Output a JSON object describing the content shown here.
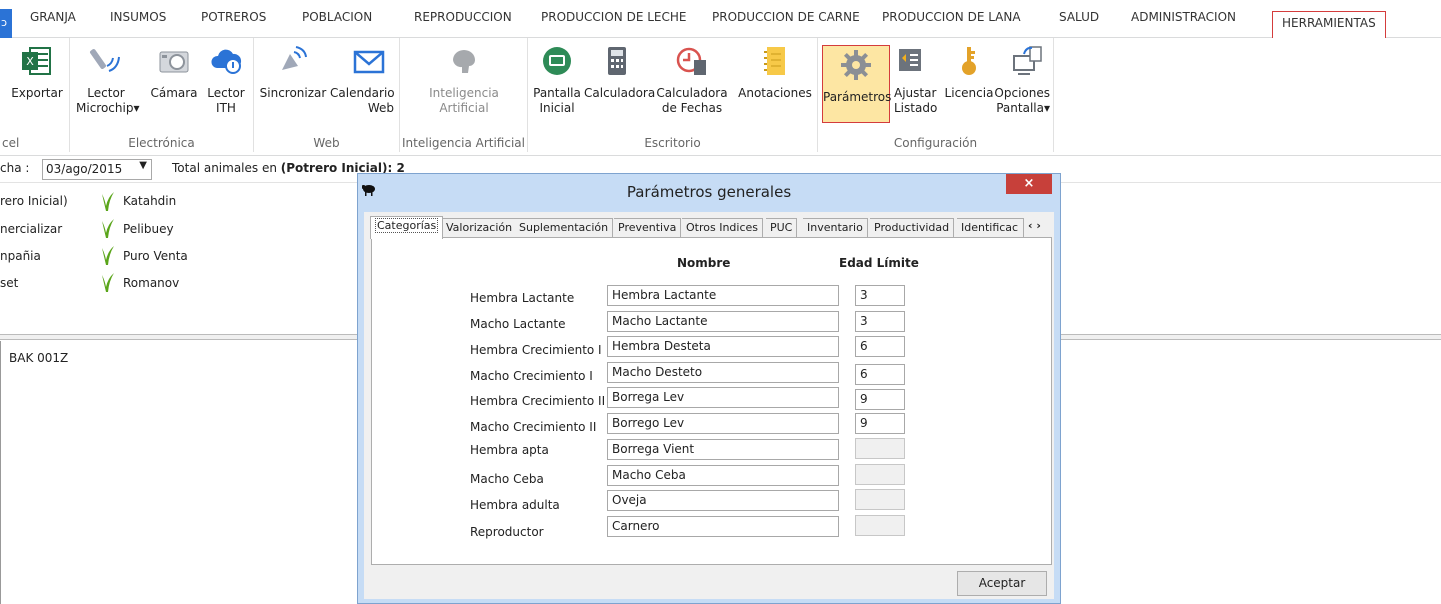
{
  "menu": {
    "file_label": "ɔ",
    "items": [
      "GRANJA",
      "INSUMOS",
      "POTREROS",
      "POBLACION",
      "REPRODUCCION",
      "PRODUCCION DE LECHE",
      "PRODUCCION DE CARNE",
      "PRODUCCION DE LANA",
      "SALUD",
      "ADMINISTRACION",
      "HERRAMIENTAS"
    ],
    "active": "HERRAMIENTAS"
  },
  "ribbon": {
    "groups": {
      "excel": {
        "label": "cel",
        "buttons": [
          "Exportar"
        ]
      },
      "electronica": {
        "label": "Electrónica",
        "buttons": [
          "Lector\nMicrochip▾",
          "Cámara",
          "Lector\nITH"
        ]
      },
      "web": {
        "label": "Web",
        "buttons": [
          "Sincronizar",
          "Calendario\nWeb"
        ]
      },
      "ia": {
        "label": "Inteligencia Artificial",
        "buttons": [
          "Inteligencia\nArtificial"
        ]
      },
      "escritorio": {
        "label": "Escritorio",
        "buttons": [
          "Pantalla\nInicial",
          "Calculadora",
          "Calculadora\nde Fechas",
          "Anotaciones"
        ]
      },
      "configuracion": {
        "label": "Configuración",
        "buttons": [
          "Parámetros",
          "Ajustar\nListado",
          "Licencia",
          "Opciones\nPantalla▾"
        ]
      }
    },
    "icons": {
      "exportar": "excel-icon",
      "microchip": "antenna-icon",
      "camara": "camera-icon",
      "ith": "cloud-icon",
      "sincronizar": "satellite-icon",
      "calendario": "mail-icon",
      "ia": "brain-icon",
      "pantalla": "screen-icon",
      "calculadora": "calculator-icon",
      "fechas": "clock-calculator-icon",
      "anotaciones": "notebook-icon",
      "parametros": "gear-icon",
      "ajustar": "list-adjust-icon",
      "licencia": "key-icon",
      "opciones": "monitor-icon"
    }
  },
  "filter": {
    "label": "cha :",
    "date": "03/ago/2015",
    "total_prefix": "Total animales en ",
    "total_bold": "(Potrero Inicial)",
    "total_value": ": 2"
  },
  "list": {
    "col1": [
      "rero Inicial)",
      "nercializar",
      "npañia",
      "set"
    ],
    "col2": [
      "Katahdin",
      "Pelibuey",
      "Puro Venta",
      "Romanov"
    ]
  },
  "bottom": {
    "code": "BAK 001Z"
  },
  "dialog": {
    "title": "Parámetros generales",
    "close": "×",
    "tabs": [
      "Categorías",
      "Valorización",
      "Suplementación",
      "Preventiva",
      "Otros Indices",
      "PUC",
      "Inventario",
      "Productividad",
      "Identificac"
    ],
    "nav": "‹ ›",
    "col_nombre": "Nombre",
    "col_edad": "Edad Límite",
    "rows": [
      {
        "label": "Hembra Lactante",
        "nombre": "Hembra Lactante",
        "edad": "3"
      },
      {
        "label": "Macho Lactante",
        "nombre": "Macho Lactante",
        "edad": "3"
      },
      {
        "label": "Hembra Crecimiento I",
        "nombre": "Hembra Desteta",
        "edad": "6"
      },
      {
        "label": "Macho Crecimiento I",
        "nombre": "Macho Desteto",
        "edad": "6"
      },
      {
        "label": "Hembra Crecimiento II",
        "nombre": "Borrega Lev",
        "edad": "9"
      },
      {
        "label": "Macho Crecimiento II",
        "nombre": "Borrego Lev",
        "edad": "9"
      },
      {
        "label": "Hembra apta",
        "nombre": "Borrega Vient",
        "edad": ""
      },
      {
        "label": "Macho Ceba",
        "nombre": "Macho Ceba",
        "edad": ""
      },
      {
        "label": "Hembra adulta",
        "nombre": "Oveja",
        "edad": ""
      },
      {
        "label": "Reproductor",
        "nombre": "Carnero",
        "edad": ""
      }
    ],
    "accept": "Aceptar"
  },
  "colors": {
    "accent": "#2b73d6",
    "selected_border": "#d43c3c",
    "selected_fill": "#fde6a3",
    "dialog_frame": "#c6dcf5",
    "close": "#c7403a"
  }
}
